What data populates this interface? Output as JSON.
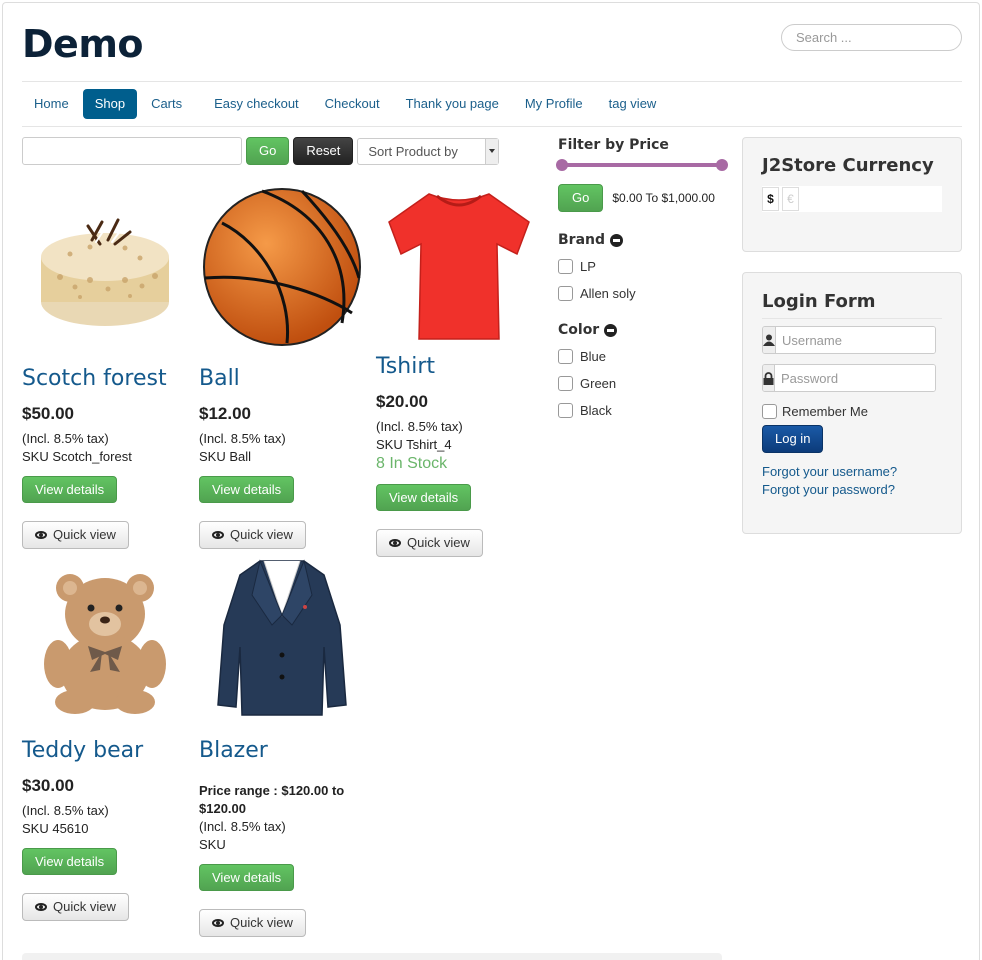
{
  "site": {
    "title": "Demo"
  },
  "search": {
    "placeholder": "Search ..."
  },
  "nav": [
    {
      "label": "Home"
    },
    {
      "label": "Shop",
      "active": true
    },
    {
      "label": "Carts"
    },
    {
      "label": "Easy checkout"
    },
    {
      "label": "Checkout"
    },
    {
      "label": "Thank you page"
    },
    {
      "label": "My Profile"
    },
    {
      "label": "tag view"
    }
  ],
  "toolbar": {
    "go_label": "Go",
    "reset_label": "Reset",
    "sort_label": "Sort Product by"
  },
  "products": [
    {
      "name": "Scotch forest",
      "price": "$50.00",
      "tax": "(Incl. 8.5% tax)",
      "sku": "SKU Scotch_forest",
      "view_label": "View details",
      "quick_label": "Quick view",
      "image": "cake-image"
    },
    {
      "name": "Ball",
      "price": "$12.00",
      "tax": "(Incl. 8.5% tax)",
      "sku": "SKU Ball",
      "view_label": "View details",
      "quick_label": "Quick view",
      "image": "basketball-image"
    },
    {
      "name": "Tshirt",
      "price": "$20.00",
      "tax": "(Incl. 8.5% tax)",
      "sku": "SKU Tshirt_4",
      "stock": "8 In Stock",
      "view_label": "View details",
      "quick_label": "Quick view",
      "image": "tshirt-image"
    },
    {
      "name": "Teddy bear",
      "price": "$30.00",
      "tax": "(Incl. 8.5% tax)",
      "sku": "SKU 45610",
      "view_label": "View details",
      "quick_label": "Quick view",
      "image": "teddy-bear-image"
    },
    {
      "name": "Blazer",
      "price_range": "Price range : $120.00 to $120.00",
      "tax": "(Incl. 8.5% tax)",
      "sku": "SKU",
      "view_label": "View details",
      "quick_label": "Quick view",
      "image": "blazer-image"
    }
  ],
  "filter": {
    "price_title": "Filter by Price",
    "go_label": "Go",
    "range_text": "$0.00 To $1,000.00",
    "brand_title": "Brand",
    "brands": [
      "LP",
      "Allen soly"
    ],
    "color_title": "Color",
    "colors": [
      "Blue",
      "Green",
      "Black"
    ],
    "slider_color": "#a86aa4"
  },
  "currency": {
    "title": "J2Store Currency",
    "symbols": [
      "$",
      "€"
    ]
  },
  "login": {
    "title": "Login Form",
    "username_placeholder": "Username",
    "password_placeholder": "Password",
    "remember_label": "Remember Me",
    "login_label": "Log in",
    "forgot_username": "Forgot your username?",
    "forgot_password": "Forgot your password?"
  },
  "colors": {
    "link": "#14598c",
    "nav_active": "#005e8d",
    "green": "#5bb75b",
    "login_button": "#0c3b7a"
  }
}
